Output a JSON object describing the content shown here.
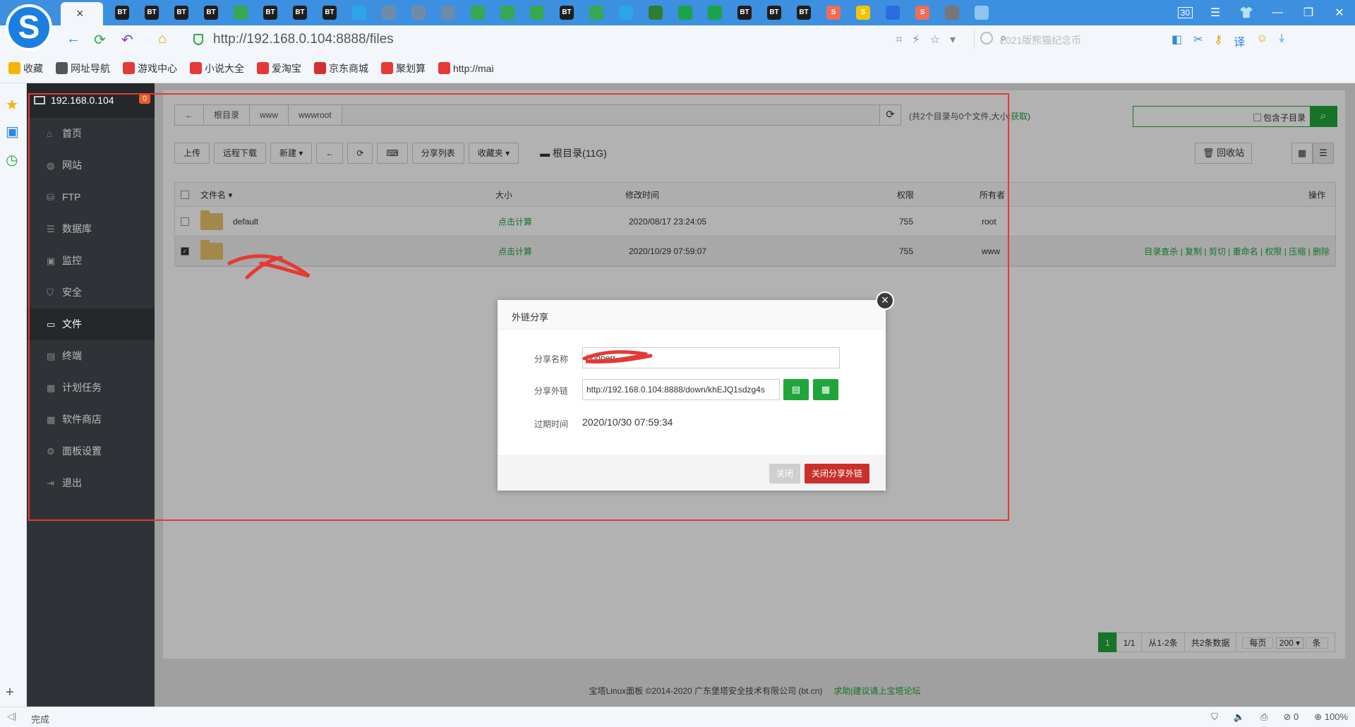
{
  "browser": {
    "logo": "S",
    "active_tab_close": "×",
    "tab_icons": [
      {
        "label": "BT",
        "color": "#1e1e1e"
      },
      {
        "label": "BT",
        "color": "#1e1e1e"
      },
      {
        "label": "BT",
        "color": "#1e1e1e"
      },
      {
        "label": "BT",
        "color": "#1e1e1e"
      },
      {
        "label": "",
        "color": "#34a853"
      },
      {
        "label": "BT",
        "color": "#1e1e1e"
      },
      {
        "label": "BT",
        "color": "#1e1e1e"
      },
      {
        "label": "BT",
        "color": "#1e1e1e"
      },
      {
        "label": "",
        "color": "#2aa6e8"
      },
      {
        "label": "",
        "color": "#6d8cab"
      },
      {
        "label": "",
        "color": "#6d8cab"
      },
      {
        "label": "",
        "color": "#6d8cab"
      },
      {
        "label": "",
        "color": "#34a853"
      },
      {
        "label": "",
        "color": "#34a853"
      },
      {
        "label": "",
        "color": "#34a853"
      },
      {
        "label": "BT",
        "color": "#1e1e1e"
      },
      {
        "label": "",
        "color": "#34a853"
      },
      {
        "label": "",
        "color": "#2aa6e8"
      },
      {
        "label": "",
        "color": "#2e7d32"
      },
      {
        "label": "",
        "color": "#1aa34a"
      },
      {
        "label": "",
        "color": "#1aa34a"
      },
      {
        "label": "BT",
        "color": "#1e1e1e"
      },
      {
        "label": "BT",
        "color": "#1e1e1e"
      },
      {
        "label": "BT",
        "color": "#1e1e1e"
      },
      {
        "label": "S",
        "color": "#ef6c57"
      },
      {
        "label": "S",
        "color": "#f5c400"
      },
      {
        "label": "",
        "color": "#2b6de0"
      },
      {
        "label": "S",
        "color": "#ef6c57"
      },
      {
        "label": "",
        "color": "#777777"
      },
      {
        "label": "",
        "color": "#8fc3f0"
      }
    ],
    "tab_count": "30",
    "url": "http://192.168.0.104:8888/files",
    "search_placeholder": "2021版熊猫纪念币",
    "bookmarks": [
      {
        "label": "收藏",
        "icon": "star-icon",
        "color": "#f5b400"
      },
      {
        "label": "网址导航",
        "icon": "globe-icon",
        "color": "#555555"
      },
      {
        "label": "游戏中心",
        "icon": "game-icon",
        "color": "#e53935"
      },
      {
        "label": "小说大全",
        "icon": "book-icon",
        "color": "#e53935"
      },
      {
        "label": "爱淘宝",
        "icon": "taobao-icon",
        "color": "#e53935"
      },
      {
        "label": "京东商城",
        "icon": "jd-icon",
        "color": "#d32f2f"
      },
      {
        "label": "聚划算",
        "icon": "juhuasuan-icon",
        "color": "#e53935"
      },
      {
        "label": "http://mai",
        "icon": "page-icon",
        "color": "#e53935"
      }
    ],
    "status_text": "完成",
    "status_count": "0",
    "zoom": "100%"
  },
  "panel": {
    "host": "192.168.0.104",
    "badge": "0",
    "menu": [
      {
        "label": "首页",
        "icon": "⌂",
        "active": false
      },
      {
        "label": "网站",
        "icon": "◍",
        "active": false
      },
      {
        "label": "FTP",
        "icon": "⛁",
        "active": false
      },
      {
        "label": "数据库",
        "icon": "☰",
        "active": false
      },
      {
        "label": "监控",
        "icon": "▣",
        "active": false
      },
      {
        "label": "安全",
        "icon": "⛉",
        "active": false
      },
      {
        "label": "文件",
        "icon": "▭",
        "active": true
      },
      {
        "label": "终端",
        "icon": "▤",
        "active": false
      },
      {
        "label": "计划任务",
        "icon": "▦",
        "active": false
      },
      {
        "label": "软件商店",
        "icon": "▩",
        "active": false
      },
      {
        "label": "面板设置",
        "icon": "⚙",
        "active": false
      },
      {
        "label": "退出",
        "icon": "⇥",
        "active": false
      }
    ]
  },
  "files": {
    "breadcrumb": [
      "根目录",
      "www",
      "wwwroot"
    ],
    "summary": "(共2个目录与0个文件,大小:",
    "summary_link": "获取",
    "summary_end": ")",
    "include_sub": "包含子目录",
    "buttons": [
      "上传",
      "远程下载",
      "新建 ▾",
      "←",
      "⟳",
      "⌨",
      "分享列表",
      "收藏夹 ▾"
    ],
    "disk": "根目录(11G)",
    "recycle": "回收站",
    "columns": {
      "name": "文件名",
      "size": "大小",
      "mtime": "修改时间",
      "perm": "权限",
      "owner": "所有者",
      "ops": "操作"
    },
    "rows": [
      {
        "name": "default",
        "size": "点击计算",
        "mtime": "2020/08/17 23:24:05",
        "perm": "755",
        "owner": "root",
        "checked": false,
        "ops": ""
      },
      {
        "name": "",
        "size": "点击计算",
        "mtime": "2020/10/29 07:59:07",
        "perm": "755",
        "owner": "www",
        "checked": true,
        "ops": "目录查杀 | 复制 | 剪切 | 重命名 | 权限 | 压缩 | 删除"
      }
    ],
    "pager": {
      "current": "1",
      "pages": "1/1",
      "range": "从1-2条",
      "total": "共2条数据",
      "per_page_label": "每页",
      "per_page": "200 ▾",
      "unit": "条"
    },
    "footer": "宝塔Linux面板 ©2014-2020 广东堡塔安全技术有限公司 (bt.cn)",
    "footer_link": "求助|建议请上宝塔论坛"
  },
  "modal": {
    "title": "外链分享",
    "name_label": "分享名称",
    "name_value": "bonnerr",
    "link_label": "分享外链",
    "link_value": "http://192.168.0.104:8888/down/khEJQ1sdzg4s",
    "expire_label": "过期时间",
    "expire_value": "2020/10/30 07:59:34",
    "close_btn": "关闭",
    "close_share_btn": "关闭分享外链"
  }
}
